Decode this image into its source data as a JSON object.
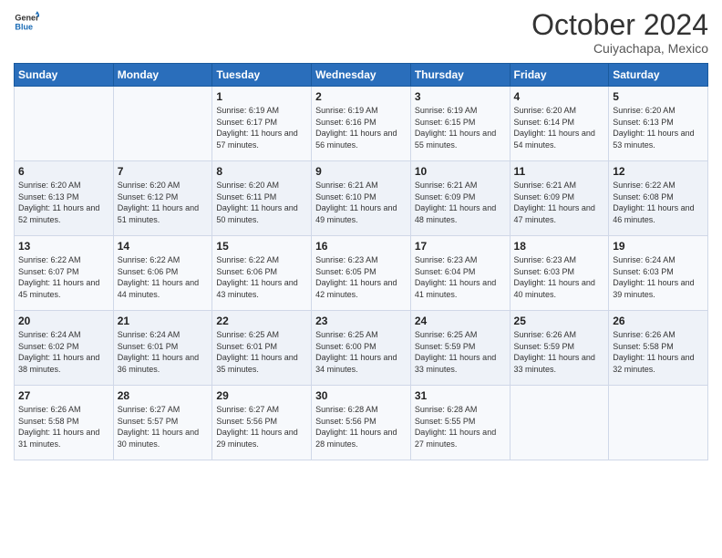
{
  "header": {
    "logo_line1": "General",
    "logo_line2": "Blue",
    "month": "October 2024",
    "location": "Cuiyachapa, Mexico"
  },
  "weekdays": [
    "Sunday",
    "Monday",
    "Tuesday",
    "Wednesday",
    "Thursday",
    "Friday",
    "Saturday"
  ],
  "weeks": [
    [
      null,
      null,
      {
        "day": 1,
        "sunrise": "6:19 AM",
        "sunset": "6:17 PM",
        "daylight": "11 hours and 57 minutes."
      },
      {
        "day": 2,
        "sunrise": "6:19 AM",
        "sunset": "6:16 PM",
        "daylight": "11 hours and 56 minutes."
      },
      {
        "day": 3,
        "sunrise": "6:19 AM",
        "sunset": "6:15 PM",
        "daylight": "11 hours and 55 minutes."
      },
      {
        "day": 4,
        "sunrise": "6:20 AM",
        "sunset": "6:14 PM",
        "daylight": "11 hours and 54 minutes."
      },
      {
        "day": 5,
        "sunrise": "6:20 AM",
        "sunset": "6:13 PM",
        "daylight": "11 hours and 53 minutes."
      }
    ],
    [
      {
        "day": 6,
        "sunrise": "6:20 AM",
        "sunset": "6:13 PM",
        "daylight": "11 hours and 52 minutes."
      },
      {
        "day": 7,
        "sunrise": "6:20 AM",
        "sunset": "6:12 PM",
        "daylight": "11 hours and 51 minutes."
      },
      {
        "day": 8,
        "sunrise": "6:20 AM",
        "sunset": "6:11 PM",
        "daylight": "11 hours and 50 minutes."
      },
      {
        "day": 9,
        "sunrise": "6:21 AM",
        "sunset": "6:10 PM",
        "daylight": "11 hours and 49 minutes."
      },
      {
        "day": 10,
        "sunrise": "6:21 AM",
        "sunset": "6:09 PM",
        "daylight": "11 hours and 48 minutes."
      },
      {
        "day": 11,
        "sunrise": "6:21 AM",
        "sunset": "6:09 PM",
        "daylight": "11 hours and 47 minutes."
      },
      {
        "day": 12,
        "sunrise": "6:22 AM",
        "sunset": "6:08 PM",
        "daylight": "11 hours and 46 minutes."
      }
    ],
    [
      {
        "day": 13,
        "sunrise": "6:22 AM",
        "sunset": "6:07 PM",
        "daylight": "11 hours and 45 minutes."
      },
      {
        "day": 14,
        "sunrise": "6:22 AM",
        "sunset": "6:06 PM",
        "daylight": "11 hours and 44 minutes."
      },
      {
        "day": 15,
        "sunrise": "6:22 AM",
        "sunset": "6:06 PM",
        "daylight": "11 hours and 43 minutes."
      },
      {
        "day": 16,
        "sunrise": "6:23 AM",
        "sunset": "6:05 PM",
        "daylight": "11 hours and 42 minutes."
      },
      {
        "day": 17,
        "sunrise": "6:23 AM",
        "sunset": "6:04 PM",
        "daylight": "11 hours and 41 minutes."
      },
      {
        "day": 18,
        "sunrise": "6:23 AM",
        "sunset": "6:03 PM",
        "daylight": "11 hours and 40 minutes."
      },
      {
        "day": 19,
        "sunrise": "6:24 AM",
        "sunset": "6:03 PM",
        "daylight": "11 hours and 39 minutes."
      }
    ],
    [
      {
        "day": 20,
        "sunrise": "6:24 AM",
        "sunset": "6:02 PM",
        "daylight": "11 hours and 38 minutes."
      },
      {
        "day": 21,
        "sunrise": "6:24 AM",
        "sunset": "6:01 PM",
        "daylight": "11 hours and 36 minutes."
      },
      {
        "day": 22,
        "sunrise": "6:25 AM",
        "sunset": "6:01 PM",
        "daylight": "11 hours and 35 minutes."
      },
      {
        "day": 23,
        "sunrise": "6:25 AM",
        "sunset": "6:00 PM",
        "daylight": "11 hours and 34 minutes."
      },
      {
        "day": 24,
        "sunrise": "6:25 AM",
        "sunset": "5:59 PM",
        "daylight": "11 hours and 33 minutes."
      },
      {
        "day": 25,
        "sunrise": "6:26 AM",
        "sunset": "5:59 PM",
        "daylight": "11 hours and 33 minutes."
      },
      {
        "day": 26,
        "sunrise": "6:26 AM",
        "sunset": "5:58 PM",
        "daylight": "11 hours and 32 minutes."
      }
    ],
    [
      {
        "day": 27,
        "sunrise": "6:26 AM",
        "sunset": "5:58 PM",
        "daylight": "11 hours and 31 minutes."
      },
      {
        "day": 28,
        "sunrise": "6:27 AM",
        "sunset": "5:57 PM",
        "daylight": "11 hours and 30 minutes."
      },
      {
        "day": 29,
        "sunrise": "6:27 AM",
        "sunset": "5:56 PM",
        "daylight": "11 hours and 29 minutes."
      },
      {
        "day": 30,
        "sunrise": "6:28 AM",
        "sunset": "5:56 PM",
        "daylight": "11 hours and 28 minutes."
      },
      {
        "day": 31,
        "sunrise": "6:28 AM",
        "sunset": "5:55 PM",
        "daylight": "11 hours and 27 minutes."
      },
      null,
      null
    ]
  ]
}
